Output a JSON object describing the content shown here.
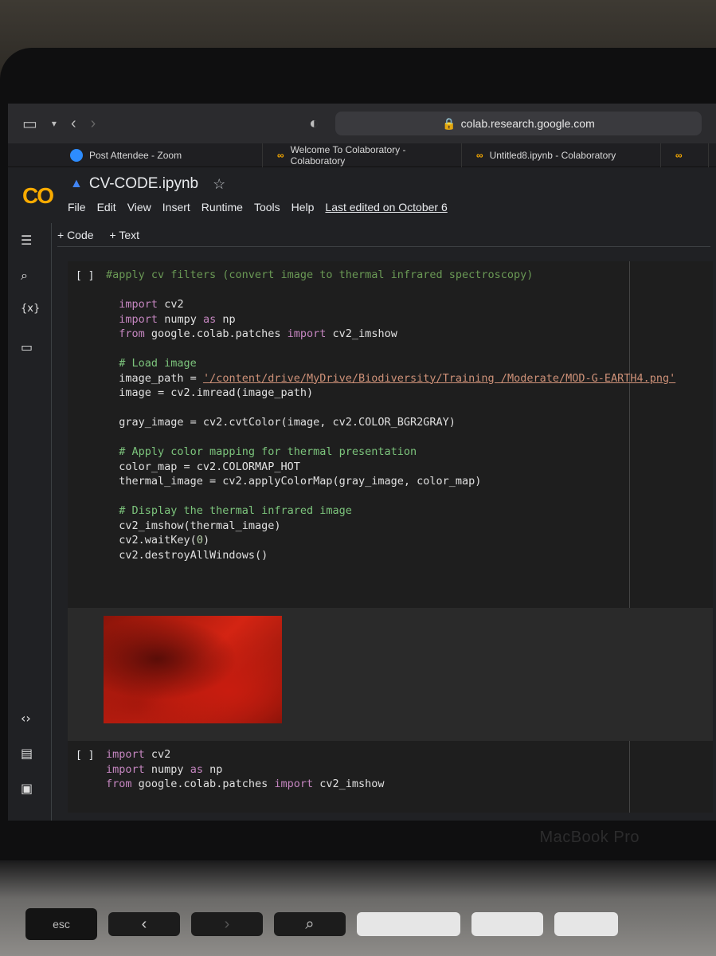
{
  "browser": {
    "address": "colab.research.google.com",
    "tabs": [
      {
        "label": "Post Attendee - Zoom",
        "icon": "zoom-icon"
      },
      {
        "label": "Welcome To Colaboratory - Colaboratory",
        "icon": "colab-icon"
      },
      {
        "label": "Untitled8.ipynb - Colaboratory",
        "icon": "colab-icon"
      }
    ]
  },
  "colab": {
    "logo": "CO",
    "title": "CV-CODE.ipynb",
    "menu": [
      "File",
      "Edit",
      "View",
      "Insert",
      "Runtime",
      "Tools",
      "Help"
    ],
    "last_edited": "Last edited on October 6",
    "add_code": "+ Code",
    "add_text": "+ Text",
    "sidebar": [
      "toc-icon",
      "search-icon",
      "variables-icon",
      "files-icon",
      "code-snippets-icon",
      "command-palette-icon",
      "terminal-icon"
    ],
    "variables_label": "{x}"
  },
  "cells": {
    "cell1": {
      "run_label": "[ ]",
      "line1": "#apply cv filters (convert image to thermal infrared spectroscopy)",
      "import1_kw": "import",
      "import1_mod": "cv2",
      "import2_kw": "import",
      "import2_mod": "numpy",
      "import2_as": "as",
      "import2_alias": "np",
      "from_kw": "from",
      "from_mod": "google.colab.patches",
      "from_import": "import",
      "from_name": "cv2_imshow",
      "comment_load": "# Load image",
      "image_path_lhs": "image_path = ",
      "image_path_str": "'/content/drive/MyDrive/Biodiversity/Training /Moderate/MOD-G-EARTH4.png'",
      "imread": "image = cv2.imread(image_path)",
      "gray": "gray_image = cv2.cvtColor(image, cv2.COLOR_BGR2GRAY)",
      "comment_map": "# Apply color mapping for thermal presentation",
      "color_map": "color_map = cv2.COLORMAP_HOT",
      "thermal": "thermal_image = cv2.applyColorMap(gray_image, color_map)",
      "comment_display": "# Display the thermal infrared image",
      "show": "cv2_imshow(thermal_image)",
      "waitkey_a": "cv2.waitKey(",
      "waitkey_n": "0",
      "waitkey_b": ")",
      "destroy": "cv2.destroyAllWindows()"
    },
    "cell2": {
      "run_label": "[ ]",
      "import1_kw": "import",
      "import1_mod": "cv2",
      "import2_kw": "import",
      "import2_mod": "numpy",
      "import2_as": "as",
      "import2_alias": "np",
      "from_kw": "from",
      "from_mod": "google.colab.patches",
      "from_import": "import",
      "from_name": "cv2_imshow"
    }
  },
  "laptop": {
    "brand": "MacBook Pro",
    "esc": "esc"
  }
}
